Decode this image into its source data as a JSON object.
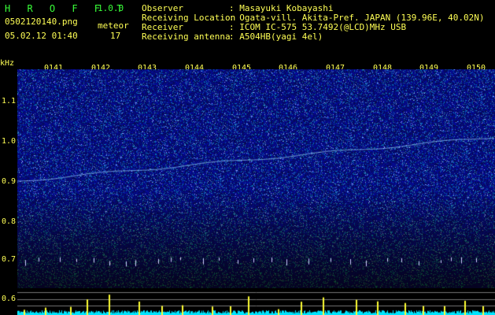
{
  "header": {
    "app_name": "H R O F F T",
    "version": "1.0.0",
    "filename": "0502120140.png",
    "datetime": "05.02.12 01:40",
    "meteor_label": "meteor",
    "meteor_count": "17",
    "fields": [
      {
        "key": "Observer",
        "value": ": Masayuki Kobayashi"
      },
      {
        "key": "Receiving Location",
        "value": ": Ogata-vill. Akita-Pref. JAPAN (139.96E, 40.02N)"
      },
      {
        "key": "Receiver",
        "value": ": ICOM IC-575 53.7492(@LCD)MHz USB"
      },
      {
        "key": "Receiving antenna",
        "value": ": A504HB(yagi 4el)"
      }
    ]
  },
  "axis": {
    "unit": "kHz",
    "y_labels": [
      "1.1",
      "1.0",
      "0.9",
      "0.8",
      "0.7",
      "0.6"
    ],
    "time_labels": [
      "0141",
      "0142",
      "0143",
      "0144",
      "0145",
      "0146",
      "0147",
      "0148",
      "0149",
      "0150"
    ]
  },
  "colors": {
    "background": "#000000",
    "noise_base": "#0a0a70",
    "trace": "#9ad8ff",
    "panel_signal": "#00e5ff",
    "spike": "#ffff33",
    "text_yellow": "#ffff55",
    "text_green": "#39ff39"
  }
}
